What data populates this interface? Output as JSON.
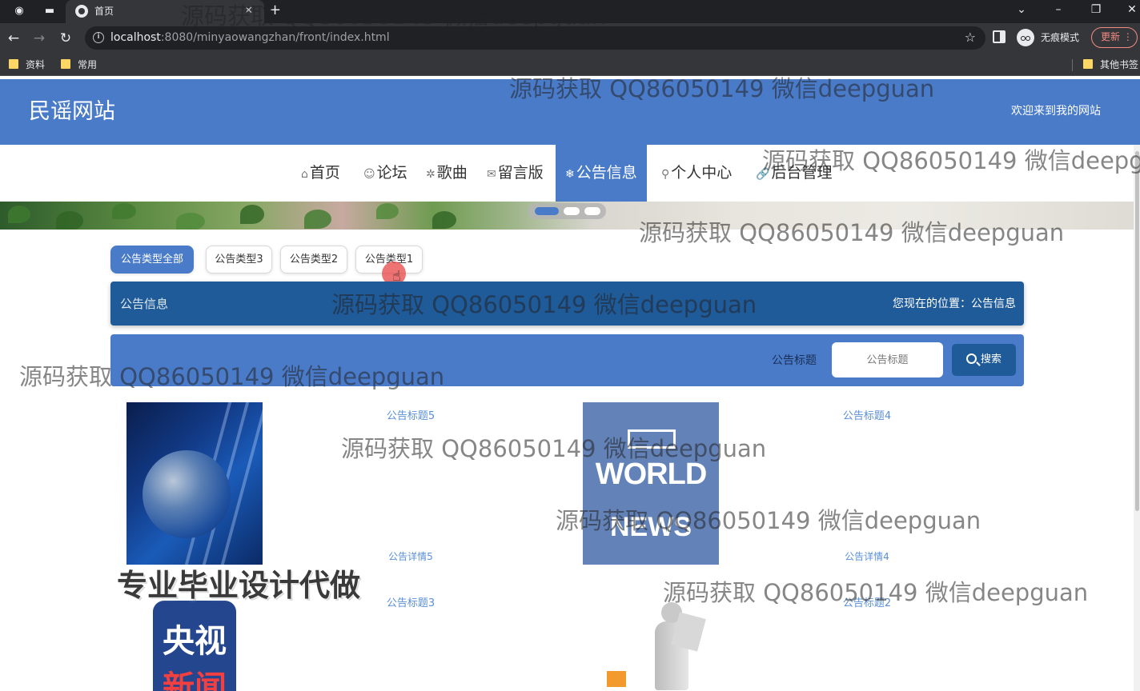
{
  "browser": {
    "tab_title": "首页",
    "url_host": "localhost",
    "url_rest": ":8080/minyaowangzhan/front/index.html",
    "incognito_label": "无痕模式",
    "update_label": "更新",
    "bookmarks": [
      "资料",
      "常用",
      "其他书签"
    ]
  },
  "site": {
    "logo": "民谣网站",
    "welcome": "欢迎来到我的网站"
  },
  "menu": [
    {
      "icon": "⌂",
      "label": "首页",
      "active": false
    },
    {
      "icon": "☺",
      "label": "论坛",
      "active": false
    },
    {
      "icon": "✲",
      "label": "歌曲",
      "active": false
    },
    {
      "icon": "✉",
      "label": "留言版",
      "active": false
    },
    {
      "icon": "❄",
      "label": "公告信息",
      "active": true
    },
    {
      "icon": "⚲",
      "label": "个人中心",
      "active": false
    },
    {
      "icon": "🔗",
      "label": "后台管理",
      "active": false
    }
  ],
  "filters": [
    "公告类型全部",
    "公告类型3",
    "公告类型2",
    "公告类型1"
  ],
  "section": {
    "title": "公告信息",
    "breadcrumb_prefix": "您现在的位置：",
    "breadcrumb_current": "公告信息"
  },
  "search": {
    "label": "公告标题",
    "placeholder": "公告标题",
    "button": "搜索"
  },
  "news": [
    {
      "title": "公告标题5",
      "detail": "公告详情5"
    },
    {
      "title": "公告标题4",
      "detail": "公告详情4"
    },
    {
      "title": "公告标题3",
      "detail": ""
    },
    {
      "title": "公告标题2",
      "detail": ""
    }
  ],
  "news_images": {
    "world_line1": "WORLD",
    "world_line2": "NEWS",
    "cctv_line1": "央视",
    "cctv_line2": "新闻"
  },
  "watermarks": {
    "repeat": "源码获取 QQ86050149 微信deepguan",
    "big": "专业毕业设计代做"
  },
  "colors": {
    "brand": "#4a7bc9",
    "dark_brand": "#1f5a99",
    "link": "#5a8fd6"
  }
}
